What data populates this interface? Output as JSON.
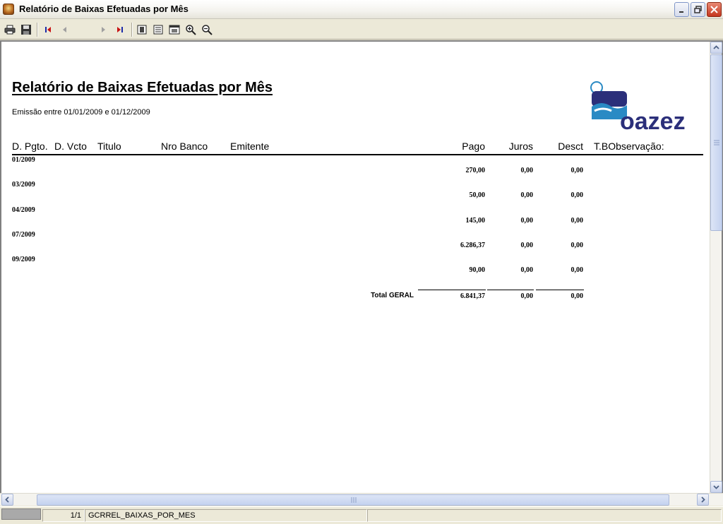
{
  "window": {
    "title": "Relatório de Baixas Efetuadas por Mês"
  },
  "toolbar": {
    "page_value": ""
  },
  "report": {
    "title": "Relatório de Baixas Efetuadas por Mês",
    "subtitle": "Emissão entre 01/01/2009 e 01/12/2009",
    "logo_text": "oazez",
    "columns": {
      "d_pgto": "D. Pgto.",
      "d_vcto": "D. Vcto",
      "titulo": "Titulo",
      "nro_banco": "Nro Banco",
      "emitente": "Emitente",
      "pago": "Pago",
      "juros": "Juros",
      "desct": "Desct",
      "tb_obs": "T.BObservação:"
    },
    "groups": [
      {
        "month": "01/2009",
        "pago": "270,00",
        "juros": "0,00",
        "desct": "0,00"
      },
      {
        "month": "03/2009",
        "pago": "50,00",
        "juros": "0,00",
        "desct": "0,00"
      },
      {
        "month": "04/2009",
        "pago": "145,00",
        "juros": "0,00",
        "desct": "0,00"
      },
      {
        "month": "07/2009",
        "pago": "6.286,37",
        "juros": "0,00",
        "desct": "0,00"
      },
      {
        "month": "09/2009",
        "pago": "90,00",
        "juros": "0,00",
        "desct": "0,00"
      }
    ],
    "total": {
      "label": "Total GERAL",
      "pago": "6.841,37",
      "juros": "0,00",
      "desct": "0,00"
    }
  },
  "statusbar": {
    "page": "1/1",
    "report_name": "GCRREL_BAIXAS_POR_MES"
  },
  "colors": {
    "logo_blue": "#2a8ac4",
    "logo_navy": "#2b2f7a"
  }
}
